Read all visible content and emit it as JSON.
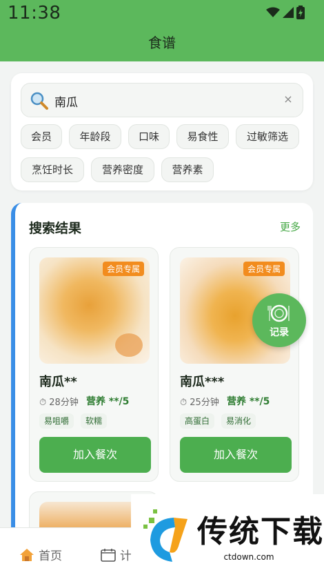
{
  "status_bar": {
    "time": "11:38"
  },
  "header": {
    "title": "食谱"
  },
  "search": {
    "value": "南瓜",
    "clear_symbol": "×"
  },
  "filters": [
    "会员",
    "年龄段",
    "口味",
    "易食性",
    "过敏筛选",
    "烹饪时长",
    "营养密度",
    "营养素"
  ],
  "results": {
    "title": "搜索结果",
    "more_label": "更多",
    "items": [
      {
        "badge": "会员专属",
        "name": "南瓜**",
        "time": "28分钟",
        "nutrition": "营养 **/5",
        "tags": [
          "易咀嚼",
          "软糯"
        ],
        "add_label": "加入餐次"
      },
      {
        "badge": "会员专属",
        "name": "南瓜***",
        "time": "25分钟",
        "nutrition": "营养 **/5",
        "tags": [
          "高蛋白",
          "易消化"
        ],
        "add_label": "加入餐次"
      }
    ]
  },
  "fab": {
    "label": "记录"
  },
  "bottom_nav": {
    "items": [
      {
        "label": "首页"
      },
      {
        "label": "计"
      }
    ]
  },
  "watermark": {
    "brand": "传统下载",
    "url": "ctdown.com"
  },
  "colors": {
    "primary_green": "#5cb85c",
    "button_green": "#4cae4f",
    "badge_orange": "#f28c1e",
    "accent_blue": "#3a8ee6"
  }
}
